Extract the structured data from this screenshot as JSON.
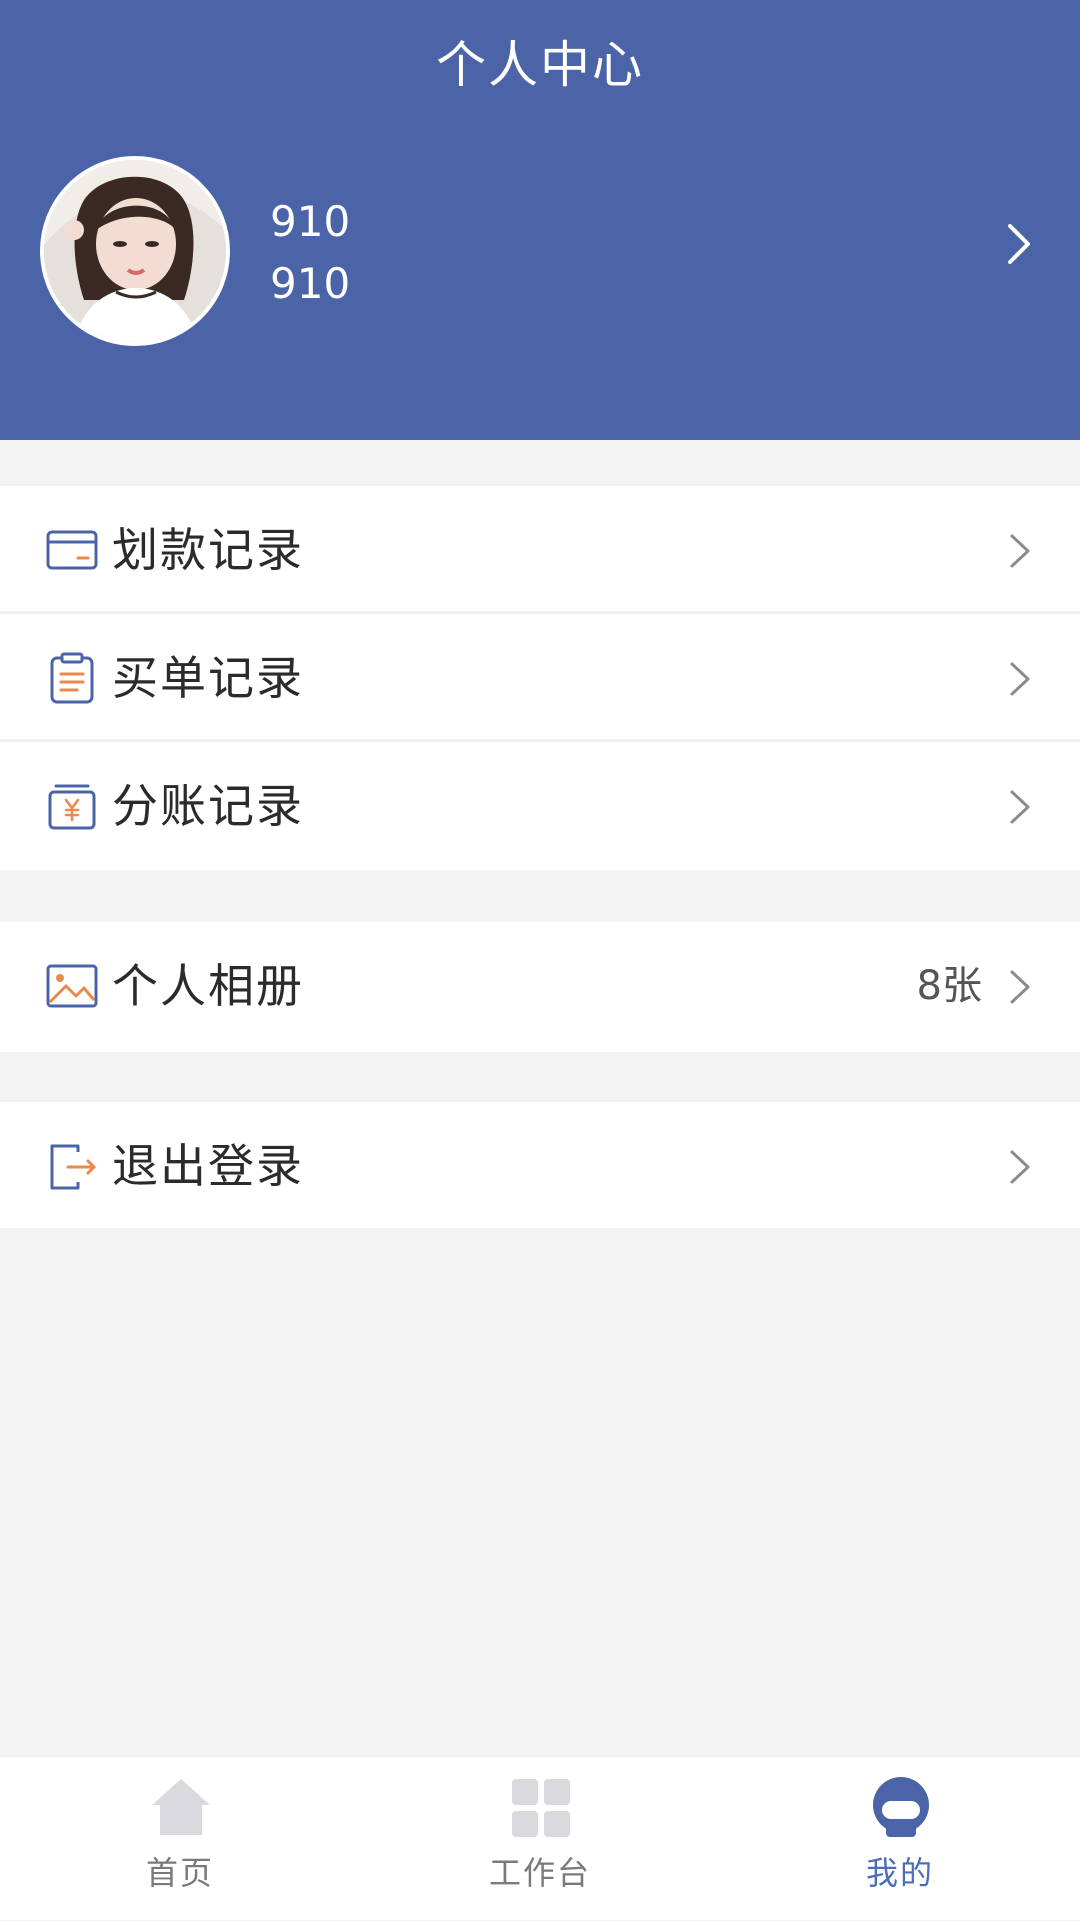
{
  "header": {
    "title": "个人中心",
    "background_color": "#4b64a7"
  },
  "profile": {
    "name": "910",
    "account": "910",
    "avatar_icon": "user-avatar-photo"
  },
  "menu": {
    "records": [
      {
        "label": "划款记录",
        "icon": "card-icon"
      },
      {
        "label": "买单记录",
        "icon": "clipboard-icon"
      },
      {
        "label": "分账记录",
        "icon": "yen-box-icon"
      }
    ],
    "album": {
      "label": "个人相册",
      "value": "8张",
      "icon": "image-icon"
    },
    "logout": {
      "label": "退出登录",
      "icon": "logout-icon"
    }
  },
  "tabbar": {
    "items": [
      {
        "label": "首页",
        "icon": "home-icon",
        "active": false
      },
      {
        "label": "工作台",
        "icon": "grid-icon",
        "active": false
      },
      {
        "label": "我的",
        "icon": "user-icon",
        "active": true
      }
    ],
    "active_color": "#4a6fb8",
    "inactive_color": "#d9d9de"
  }
}
